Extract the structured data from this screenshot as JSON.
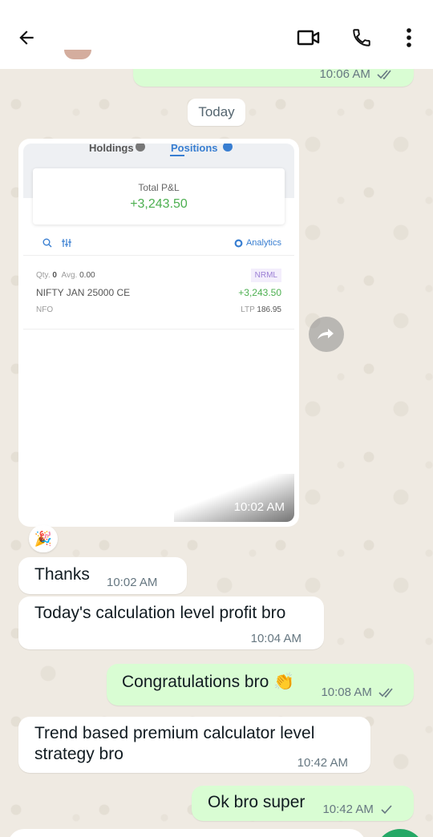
{
  "header": {
    "back_icon": "arrow-left-icon",
    "video_icon": "video-call-icon",
    "call_icon": "phone-icon",
    "menu_icon": "more-vert-icon"
  },
  "messages": {
    "top_out": {
      "time": "10:06 AM"
    },
    "date_chip": "Today",
    "screenshot": {
      "tabs": {
        "holdings": "Holdings",
        "positions": "Positions"
      },
      "total_pnl_label": "Total P&L",
      "total_pnl_value": "+3,243.50",
      "analytics_label": "Analytics",
      "position": {
        "qty_label": "Qty.",
        "qty_value": "0",
        "avg_label": "Avg.",
        "avg_value": "0.00",
        "product": "NRML",
        "symbol": "NIFTY JAN 25000 CE",
        "pnl": "+3,243.50",
        "exchange": "NFO",
        "ltp_label": "LTP",
        "ltp_value": "186.95"
      },
      "time": "10:02 AM"
    },
    "reaction_emoji": "🎉",
    "thanks": {
      "text": "Thanks",
      "time": "10:02 AM"
    },
    "calc": {
      "text": "Today's calculation level profit bro",
      "time": "10:04 AM"
    },
    "congrats": {
      "text": "Congratulations bro",
      "emoji": "👏",
      "time": "10:08 AM"
    },
    "trend": {
      "line1": "Trend based premium calculator level",
      "line2": "strategy bro",
      "time": "10:42 AM"
    },
    "ok": {
      "text": "Ok bro super",
      "time": "10:42 AM"
    }
  },
  "colors": {
    "outgoing": "#d9fdd3",
    "incoming": "#ffffff",
    "accent": "#25a866",
    "tick_read": "#667781"
  }
}
